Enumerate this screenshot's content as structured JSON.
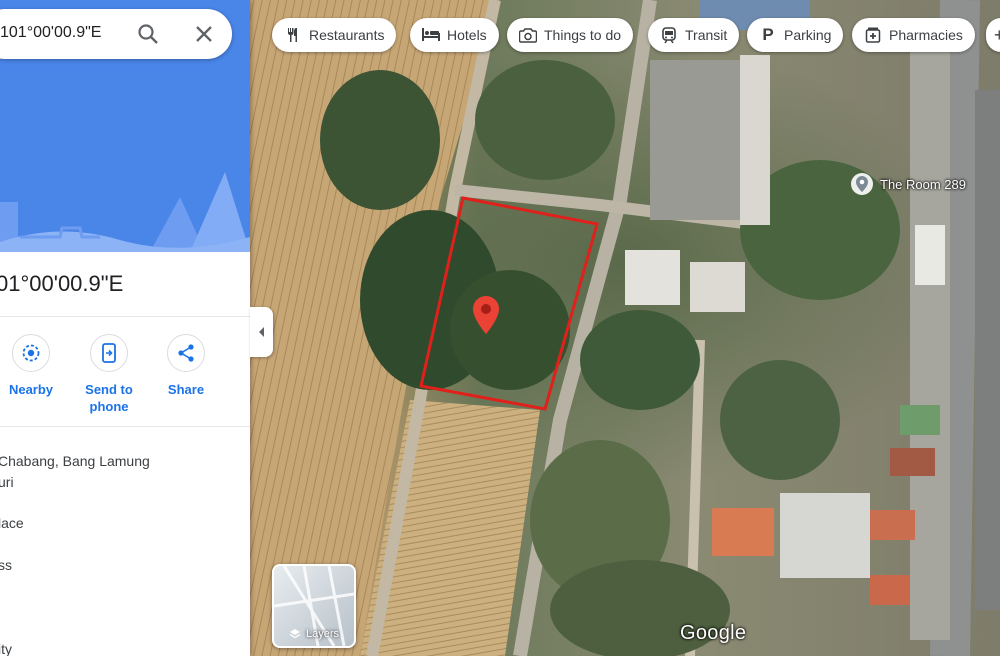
{
  "search": {
    "query": "101°00'00.9\"E"
  },
  "place": {
    "title": "01°00'00.9\"E",
    "actions": [
      {
        "label": "Nearby",
        "icon": "nearby-icon"
      },
      {
        "label": "Send to phone",
        "icon": "send-to-phone-icon"
      },
      {
        "label": "Share",
        "icon": "share-icon"
      }
    ],
    "address_line1": "Chabang, Bang Lamung",
    "address_line2": "uri",
    "info_items": [
      "lace",
      "ss",
      "ity"
    ]
  },
  "chips": [
    {
      "label": "Restaurants",
      "icon": "restaurant-icon"
    },
    {
      "label": "Hotels",
      "icon": "hotel-icon"
    },
    {
      "label": "Things to do",
      "icon": "camera-icon"
    },
    {
      "label": "Transit",
      "icon": "transit-icon"
    },
    {
      "label": "Parking",
      "icon": "parking-icon"
    },
    {
      "label": "Pharmacies",
      "icon": "pharmacy-icon"
    }
  ],
  "map": {
    "poi_label": "The Room 289",
    "layers_label": "Layers",
    "logo": "Google",
    "boundary_color": "#e0201a",
    "pin_color": "#ea4335"
  }
}
